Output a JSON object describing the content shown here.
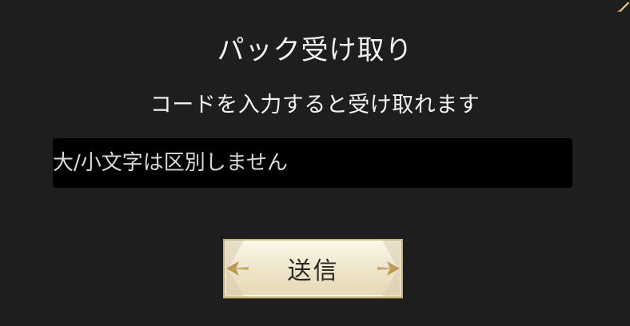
{
  "dialog": {
    "title": "パック受け取り",
    "subtitle": "コードを入力すると受け取れます",
    "code_input": {
      "value": "",
      "placeholder": "大/小文字は区別しません"
    },
    "send_button": {
      "label": "送信"
    }
  },
  "colors": {
    "background": "#1e1e1e",
    "input_background": "#000000",
    "text": "#f2f2f2",
    "button_face": "#efe7cf",
    "button_border": "#c9b27a",
    "spark": "#f0d27a"
  }
}
